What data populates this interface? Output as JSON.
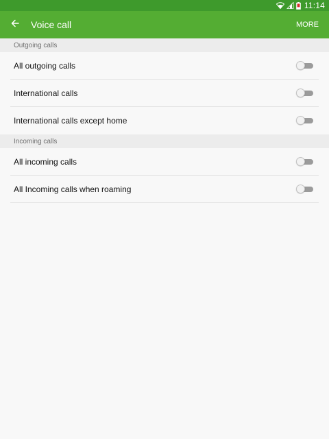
{
  "status_bar": {
    "time": "11:14",
    "icons": [
      "wifi-icon",
      "signal-icon",
      "battery-icon"
    ]
  },
  "app_bar": {
    "back_icon": "arrow-left-icon",
    "title": "Voice call",
    "more_label": "MORE"
  },
  "sections": [
    {
      "header": "Outgoing calls",
      "items": [
        {
          "label": "All outgoing calls",
          "enabled": false
        },
        {
          "label": "International calls",
          "enabled": false
        },
        {
          "label": "International calls except home",
          "enabled": false
        }
      ]
    },
    {
      "header": "Incoming calls",
      "items": [
        {
          "label": "All incoming calls",
          "enabled": false
        },
        {
          "label": "All Incoming calls when roaming",
          "enabled": false
        }
      ]
    }
  ],
  "colors": {
    "status_bar": "#3e9a2c",
    "app_bar": "#54ad33",
    "section_header_bg": "#ececec",
    "background": "#f8f8f8"
  }
}
